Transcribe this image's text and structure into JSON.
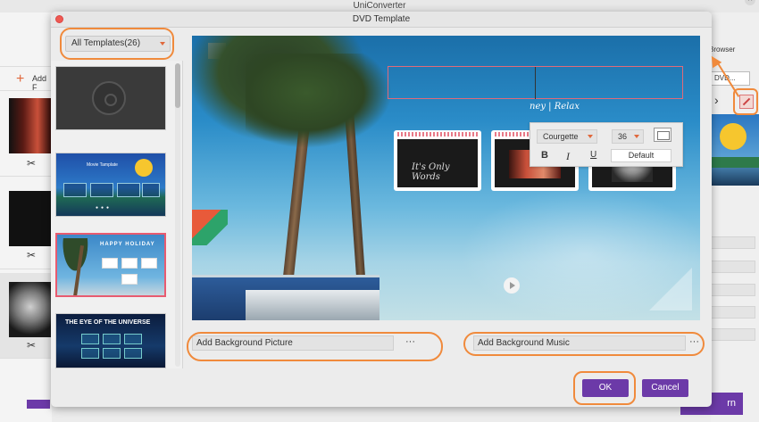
{
  "app": {
    "title": "UniConverter",
    "add_files_label": "Add F",
    "browser_label": "Browser",
    "dvd_dropdown": "DVD...",
    "start_label": "rn"
  },
  "dialog": {
    "title": "DVD Template",
    "template_filter": "All Templates(26)",
    "templates": [
      {
        "id": "blank-disc"
      },
      {
        "title": "Movie Tamplate"
      },
      {
        "title": "HAPPY HOLIDAY"
      },
      {
        "title": "THE EYE OF THE UNIVERSE"
      }
    ],
    "preview": {
      "subtitle": "ney  |  Relax",
      "card_text": "It's Only Words"
    },
    "font_toolbar": {
      "font": "Courgette",
      "size": "36",
      "bold": "B",
      "italic": "I",
      "underline": "U",
      "default_label": "Default"
    },
    "background_picture_label": "Add Background Picture",
    "background_music_label": "Add Background Music",
    "more_label": "···",
    "ok_label": "OK",
    "cancel_label": "Cancel"
  },
  "colors": {
    "accent_purple": "#6c3aa8",
    "highlight_orange": "#f08a3c",
    "selected_border": "#e85b70"
  }
}
